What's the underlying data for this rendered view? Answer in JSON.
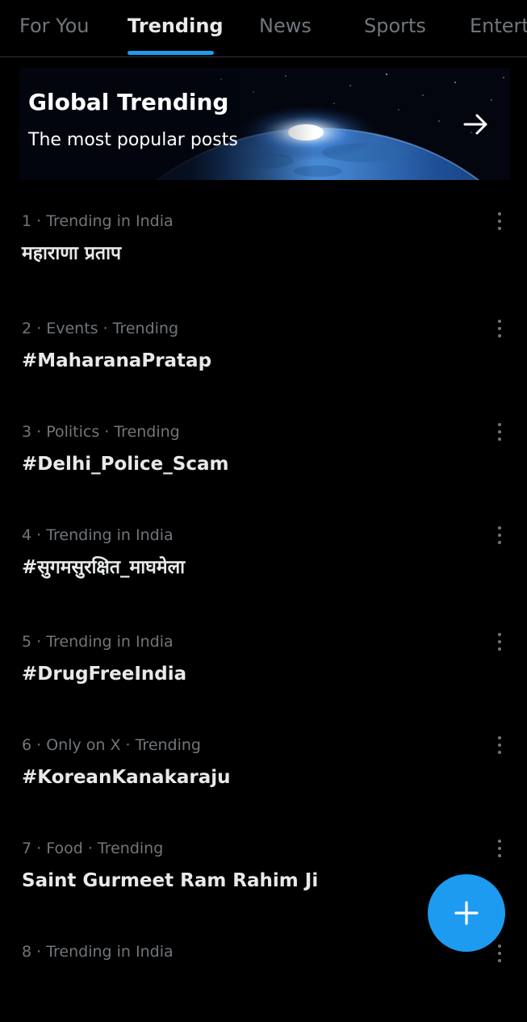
{
  "tabs": [
    {
      "label": "For You",
      "active": false
    },
    {
      "label": "Trending",
      "active": true
    },
    {
      "label": "News",
      "active": false
    },
    {
      "label": "Sports",
      "active": false
    },
    {
      "label": "Entert",
      "active": false
    }
  ],
  "banner": {
    "title": "Global Trending",
    "subtitle": "The most popular posts",
    "icon": "arrow-right-icon"
  },
  "trends": [
    {
      "meta": "1 · Trending in India",
      "name": "महाराणा प्रताप"
    },
    {
      "meta": "2 · Events · Trending",
      "name": "#MaharanaPratap"
    },
    {
      "meta": "3 · Politics · Trending",
      "name": "#Delhi_Police_Scam"
    },
    {
      "meta": "4 · Trending in India",
      "name": "#सुगमसुरक्षित_माघमेला"
    },
    {
      "meta": "5 · Trending in India",
      "name": "#DrugFreeIndia"
    },
    {
      "meta": "6 · Only on X · Trending",
      "name": "#KoreanKanakaraju"
    },
    {
      "meta": "7 · Food · Trending",
      "name": "Saint Gurmeet Ram Rahim Ji"
    },
    {
      "meta": "8 · Trending in India",
      "name": ""
    }
  ],
  "fab": {
    "icon": "plus-icon"
  },
  "colors": {
    "accent": "#1d9bf0",
    "background": "#000000",
    "text_primary": "#e7e9ea",
    "text_secondary": "#71767b",
    "divider": "#2f3336"
  }
}
